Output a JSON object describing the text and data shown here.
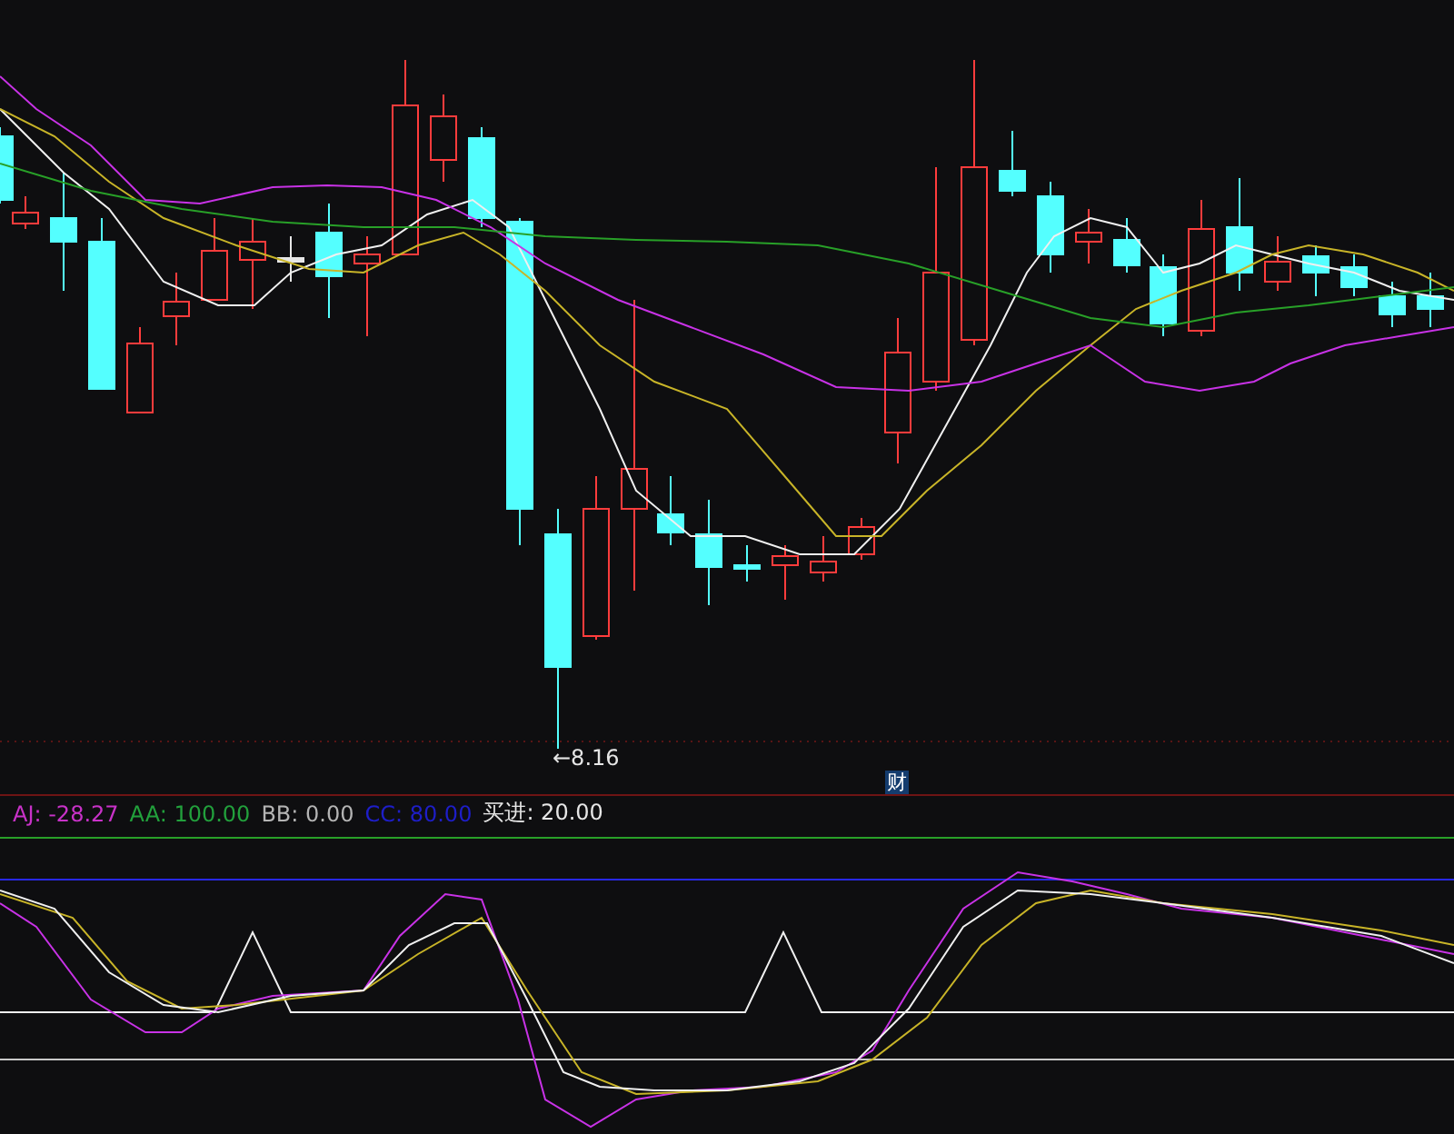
{
  "price_chart": {
    "low_price_label": "←8.16",
    "finance_badge": "财"
  },
  "indicator_legend": [
    {
      "label": "AJ: -28.27",
      "color": "#c832c8"
    },
    {
      "label": "AA: 100.00",
      "color": "#22a03c"
    },
    {
      "label": "BB: 0.00",
      "color": "#b4b4b4"
    },
    {
      "label": "CC: 80.00",
      "color": "#1e1ec8"
    },
    {
      "label": "买进: 20.00",
      "color": "#e6e6e6"
    }
  ]
}
